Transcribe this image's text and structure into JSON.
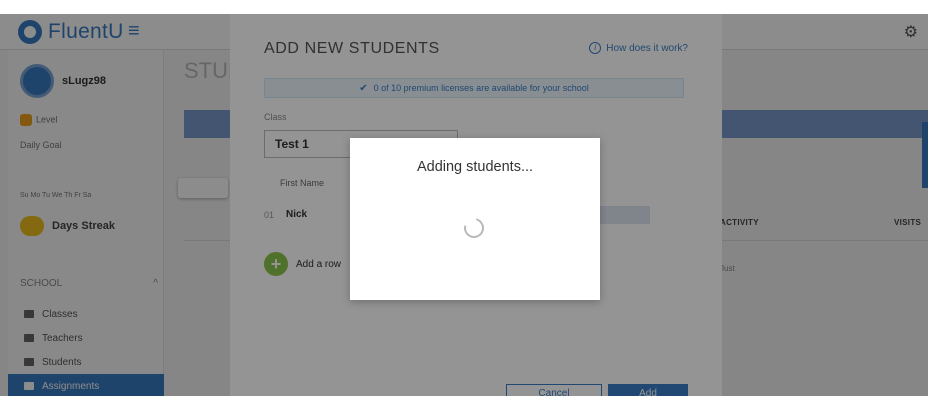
{
  "app": {
    "brand": "FluentU",
    "username": "sLugz98",
    "sidebar_lines": [
      "Level",
      "Daily Goal"
    ],
    "day_labels": "Su Mo Tu We Th Fr Sa",
    "streak": "Days Streak",
    "section": "SCHOOL",
    "nav": [
      "Classes",
      "Teachers",
      "Students",
      "Assignments"
    ],
    "page_heading": "STUD",
    "table_headers": [
      "ACTIVITY",
      "VISITS"
    ],
    "table_cell": "Just"
  },
  "modal": {
    "title": "ADD NEW STUDENTS",
    "how_link": "How does it work?",
    "notice": "0 of 10 premium licenses are available for your school",
    "class_label": "Class",
    "class_value": "Test 1",
    "col_first": "First Name",
    "col_right": "",
    "row_number": "01",
    "row_name": "Nick",
    "add_row": "Add a row",
    "cancel": "Cancel",
    "add": "Add"
  },
  "progress": {
    "text": "Adding students..."
  },
  "colors": {
    "brand": "#3a7dc4",
    "accent_green": "#8bc34a"
  }
}
